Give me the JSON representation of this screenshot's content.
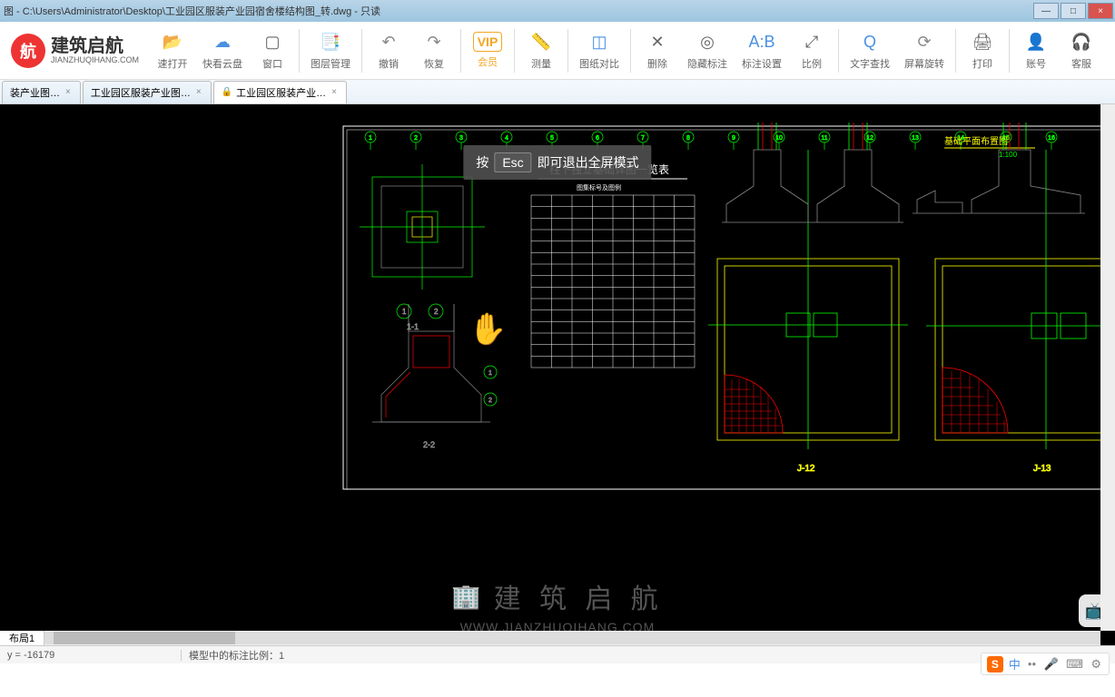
{
  "window": {
    "title": "图 - C:\\Users\\Administrator\\Desktop\\工业园区服装产业园宿舍楼结构图_转.dwg - 只读",
    "min": "—",
    "max": "□",
    "close": "×"
  },
  "brand": {
    "cn": "建筑启航",
    "en": "JIANZHUQIHANG.COM",
    "badge": "航"
  },
  "toolbar": {
    "items": [
      {
        "id": "fast-open",
        "label": "速打开",
        "icon": "📂"
      },
      {
        "id": "cloud",
        "label": "快看云盘",
        "icon": "☁"
      },
      {
        "id": "window",
        "label": "窗口",
        "icon": "▢"
      },
      {
        "id": "layer-mgr",
        "label": "图层管理",
        "icon": "📑"
      },
      {
        "id": "undo",
        "label": "撤销",
        "icon": "↶"
      },
      {
        "id": "redo",
        "label": "恢复",
        "icon": "↷"
      },
      {
        "id": "vip",
        "label": "会员",
        "icon": "VIP"
      },
      {
        "id": "measure",
        "label": "测量",
        "icon": "📏"
      },
      {
        "id": "compare",
        "label": "图纸对比",
        "icon": "◫"
      },
      {
        "id": "delete",
        "label": "删除",
        "icon": "✕"
      },
      {
        "id": "hide-anno",
        "label": "隐藏标注",
        "icon": "◎"
      },
      {
        "id": "anno-set",
        "label": "标注设置",
        "icon": "A:B"
      },
      {
        "id": "scale",
        "label": "比例",
        "icon": "⤢"
      },
      {
        "id": "find-text",
        "label": "文字查找",
        "icon": "Q"
      },
      {
        "id": "rotate",
        "label": "屏幕旋转",
        "icon": "⟳"
      },
      {
        "id": "print",
        "label": "打印",
        "icon": "🖨"
      },
      {
        "id": "account",
        "label": "账号",
        "icon": "👤"
      },
      {
        "id": "service",
        "label": "客服",
        "icon": "🎧"
      }
    ]
  },
  "tabs": [
    {
      "id": "t1",
      "label": "装产业图…",
      "active": false,
      "locked": false
    },
    {
      "id": "t2",
      "label": "工业园区服装产业图…",
      "active": false,
      "locked": false
    },
    {
      "id": "t3",
      "label": "工业园区服装产业…",
      "active": true,
      "locked": true
    }
  ],
  "fullscreen_toast": {
    "pre": "按",
    "key": "Esc",
    "post": "即可退出全屏模式"
  },
  "watermark": {
    "cn": "建 筑 启 航",
    "en": "WWW.JIANZHUQIHANG.COM"
  },
  "drawing": {
    "table_title": "柱下独立基础详图一览表",
    "table_subtitle": "图集标号及图例",
    "gridline_ids": [
      "1",
      "2",
      "3",
      "4",
      "5",
      "6",
      "7",
      "8",
      "9",
      "10",
      "11",
      "12",
      "13",
      "14",
      "15",
      "16"
    ],
    "section_label_1": "1-1",
    "section_label_2": "2-2",
    "detail_j12": "J-12",
    "detail_j13": "J-13",
    "corner_title": "基础平面布置图",
    "scale_text": "1:100"
  },
  "model_tabs": {
    "layout1": "布局1"
  },
  "status": {
    "coords": "y = -16179",
    "mid": "模型中的标注比例：1"
  },
  "ime": {
    "cn": "中"
  },
  "side_icon": "📺"
}
